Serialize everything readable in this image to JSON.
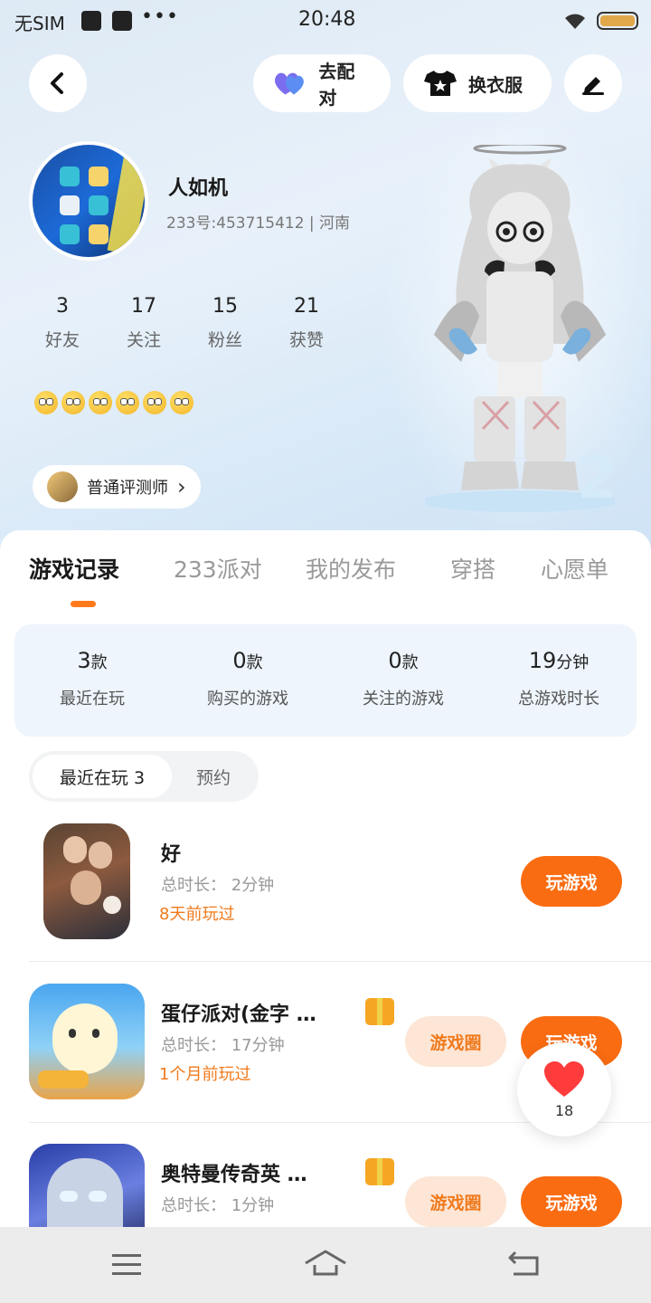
{
  "status_bar": {
    "carrier": "无SIM",
    "time": "20:48",
    "more": "•••"
  },
  "header": {
    "pair_label": "去配对",
    "outfit_label": "换衣服"
  },
  "profile": {
    "name": "人如机",
    "id_line": "233号:453715412 | 河南",
    "stats": [
      {
        "value": "3",
        "label": "好友"
      },
      {
        "value": "17",
        "label": "关注"
      },
      {
        "value": "15",
        "label": "粉丝"
      },
      {
        "value": "21",
        "label": "获赞"
      }
    ],
    "emoji_count": 6,
    "badge_label": "普通评测师",
    "badge_arrow": "›"
  },
  "tabs": [
    {
      "label": "游戏记录",
      "active": true
    },
    {
      "label": "233派对",
      "active": false
    },
    {
      "label": "我的发布",
      "active": false
    },
    {
      "label": "穿搭",
      "active": false
    },
    {
      "label": "心愿单",
      "active": false
    }
  ],
  "summary": [
    {
      "value": "3",
      "unit": "款",
      "label": "最近在玩"
    },
    {
      "value": "0",
      "unit": "款",
      "label": "购买的游戏"
    },
    {
      "value": "0",
      "unit": "款",
      "label": "关注的游戏"
    },
    {
      "value": "19",
      "unit": "分钟",
      "label": "总游戏时长"
    }
  ],
  "segment": {
    "recent": "最近在玩 3",
    "reserve": "预约"
  },
  "games": [
    {
      "title": "好",
      "duration": "总时长： 2分钟",
      "last_played": "8天前玩过",
      "play_label": "玩游戏"
    },
    {
      "title": "蛋仔派对(金字 …",
      "duration": "总时长： 17分钟",
      "last_played": "1个月前玩过",
      "circle_label": "游戏圈",
      "play_label": "玩游戏"
    },
    {
      "title": "奥特曼传奇英 …",
      "duration": "总时长： 1分钟",
      "circle_label": "游戏圈",
      "play_label": "玩游戏"
    }
  ],
  "like": {
    "count": "18"
  },
  "colors": {
    "accent": "#fa6c12",
    "accent_text": "#f07a1d",
    "summary_bg": "#eef5fc"
  }
}
